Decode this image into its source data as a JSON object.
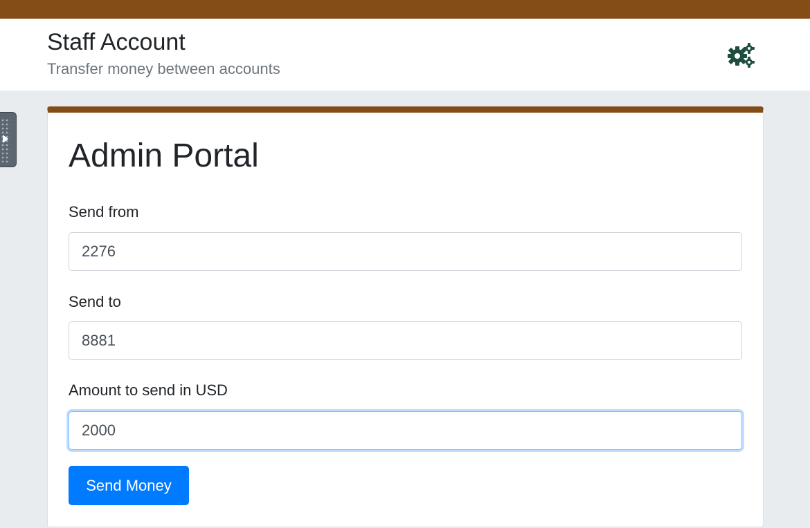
{
  "header": {
    "title": "Staff Account",
    "subtitle": "Transfer money between accounts",
    "settings_icon": "gears-icon"
  },
  "colors": {
    "brand_brown": "#844c17",
    "accent_blue": "#007bff",
    "icon_green": "#1f4d3f"
  },
  "card": {
    "title": "Admin Portal",
    "fields": [
      {
        "label": "Send from",
        "value": "2276"
      },
      {
        "label": "Send to",
        "value": "8881"
      },
      {
        "label": "Amount to send in USD",
        "value": "2000"
      }
    ],
    "submit_label": "Send Money"
  }
}
